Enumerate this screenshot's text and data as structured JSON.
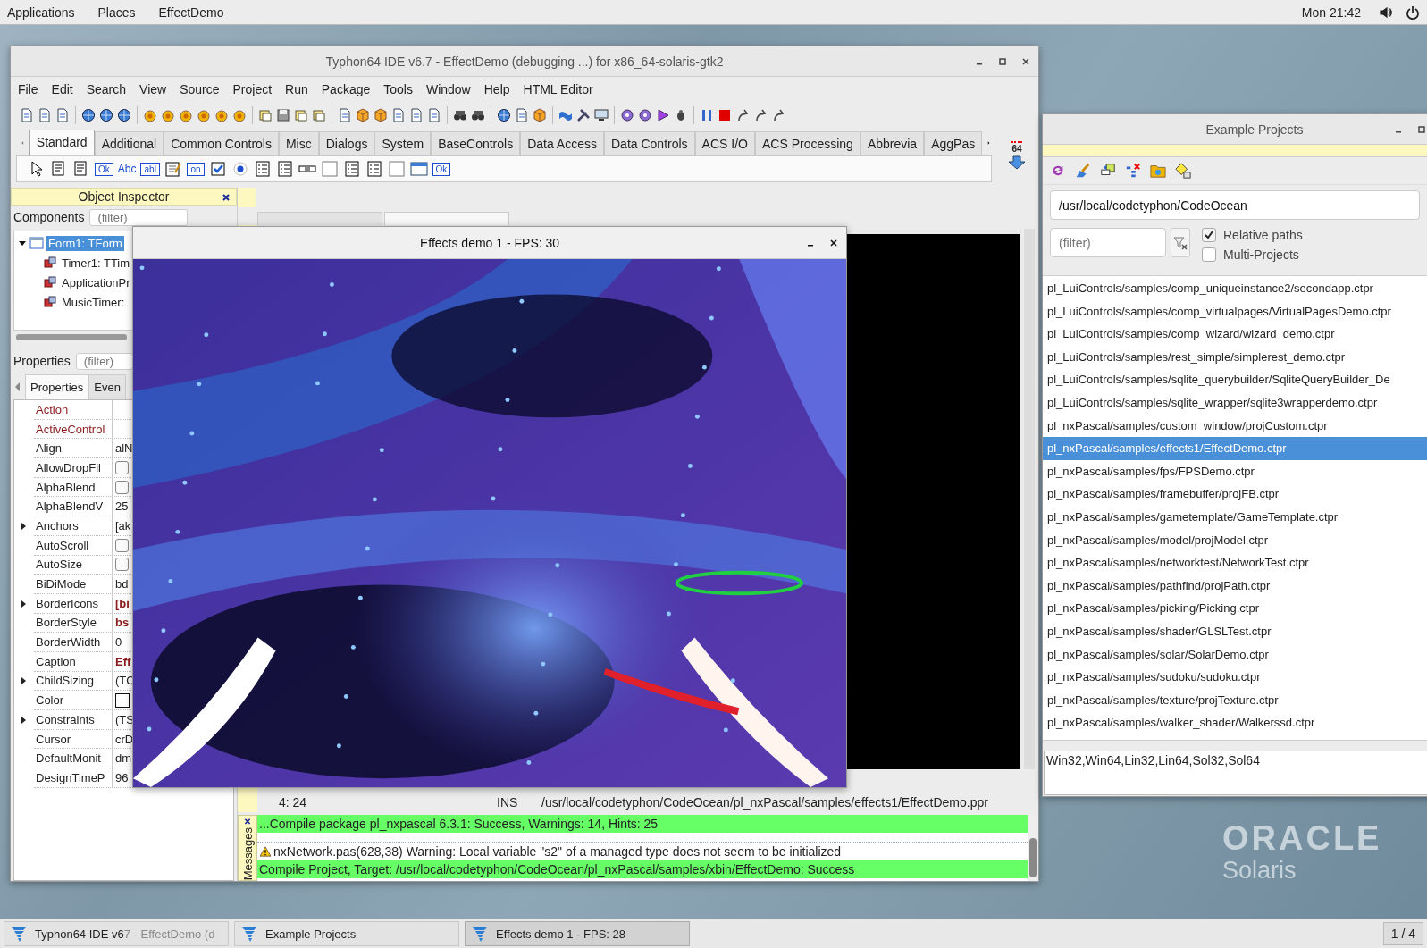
{
  "top_bar": {
    "menus": [
      "Applications",
      "Places",
      "EffectDemo"
    ],
    "clock": "Mon 21:42"
  },
  "ide": {
    "title": "Typhon64 IDE v6.7 - EffectDemo (debugging ...) for x86_64-solaris-gtk2",
    "menu": [
      "File",
      "Edit",
      "Search",
      "View",
      "Source",
      "Project",
      "Run",
      "Package",
      "Tools",
      "Window",
      "Help",
      "HTML Editor"
    ],
    "palette_tabs": [
      {
        "label": "Standard",
        "selected": true
      },
      {
        "label": "Additional",
        "selected": false
      },
      {
        "label": "Common Controls",
        "selected": false
      },
      {
        "label": "Misc",
        "selected": false
      },
      {
        "label": "Dialogs",
        "selected": false
      },
      {
        "label": "System",
        "selected": false
      },
      {
        "label": "BaseControls",
        "selected": false
      },
      {
        "label": "Data Access",
        "selected": false
      },
      {
        "label": "Data Controls",
        "selected": false
      },
      {
        "label": "ACS I/O",
        "selected": false
      },
      {
        "label": "ACS Processing",
        "selected": false
      },
      {
        "label": "Abbrevia",
        "selected": false
      },
      {
        "label": "AggPas",
        "selected": false
      }
    ],
    "palette_badge": "64",
    "palette_items": [
      {
        "kind": "pointer"
      },
      {
        "kind": "menu"
      },
      {
        "kind": "menu"
      },
      {
        "kind": "text",
        "label": "Ok"
      },
      {
        "kind": "plain",
        "label": "Abc"
      },
      {
        "kind": "text",
        "label": "abI"
      },
      {
        "kind": "memo"
      },
      {
        "kind": "text",
        "label": "on"
      },
      {
        "kind": "check"
      },
      {
        "kind": "radio"
      },
      {
        "kind": "list"
      },
      {
        "kind": "list"
      },
      {
        "kind": "bar"
      },
      {
        "kind": "panel"
      },
      {
        "kind": "list"
      },
      {
        "kind": "list"
      },
      {
        "kind": "panel"
      },
      {
        "kind": "window"
      },
      {
        "kind": "text",
        "label": "Ok"
      }
    ],
    "object_inspector": {
      "title": "Object Inspector",
      "components_label": "Components",
      "components_filter": {
        "placeholder": "(filter)"
      },
      "tree": [
        {
          "label": "Form1: TForm",
          "selected": true,
          "expanded": true,
          "children": [
            {
              "label": "Timer1: TTim",
              "selected": false
            },
            {
              "label": "ApplicationPr",
              "selected": false
            },
            {
              "label": "MusicTimer:",
              "selected": false
            }
          ]
        }
      ],
      "properties_label": "Properties",
      "properties_filter": {
        "placeholder": "(filter)"
      },
      "tabs": [
        {
          "label": "Properties",
          "selected": true
        },
        {
          "label": "Even",
          "selected": false
        }
      ],
      "properties": [
        {
          "name": "Action",
          "kind": "text",
          "reference": true
        },
        {
          "name": "ActiveControl",
          "kind": "text",
          "reference": true
        },
        {
          "name": "Align",
          "kind": "text",
          "value": "alN"
        },
        {
          "name": "AllowDropFil",
          "kind": "check",
          "checked": false
        },
        {
          "name": "AlphaBlend",
          "kind": "check",
          "checked": false
        },
        {
          "name": "AlphaBlendV",
          "kind": "text",
          "value": "25"
        },
        {
          "name": "Anchors",
          "kind": "text",
          "value": "[ak",
          "expandable": true
        },
        {
          "name": "AutoScroll",
          "kind": "check",
          "checked": false
        },
        {
          "name": "AutoSize",
          "kind": "check",
          "checked": false
        },
        {
          "name": "BiDiMode",
          "kind": "text",
          "value": "bd"
        },
        {
          "name": "BorderIcons",
          "kind": "text",
          "value": "[bi",
          "expandable": true,
          "modified": true
        },
        {
          "name": "BorderStyle",
          "kind": "text",
          "value": "bs",
          "modified": true
        },
        {
          "name": "BorderWidth",
          "kind": "text",
          "value": "0"
        },
        {
          "name": "Caption",
          "kind": "text",
          "value": "Eff",
          "modified": true
        },
        {
          "name": "ChildSizing",
          "kind": "text",
          "value": "(TC",
          "expandable": true
        },
        {
          "name": "Color",
          "kind": "color"
        },
        {
          "name": "Constraints",
          "kind": "text",
          "value": "(TS",
          "expandable": true
        },
        {
          "name": "Cursor",
          "kind": "text",
          "value": "crD"
        },
        {
          "name": "DefaultMonit",
          "kind": "text",
          "value": "dm"
        },
        {
          "name": "DesignTimeP",
          "kind": "text",
          "value": "96"
        }
      ]
    },
    "editor": {
      "position": "4: 24",
      "mode": "INS",
      "file": "/usr/local/codetyphon/CodeOcean/pl_nxPascal/samples/effects1/EffectDemo.ppr"
    },
    "messages": {
      "title": "Messages",
      "rows": [
        {
          "kind": "success",
          "text": "...Compile package pl_nxpascal 6.3.1: Success, Warnings: 14, Hints: 25"
        },
        {
          "kind": "warning",
          "text": "nxNetwork.pas(628,38) Warning: Local variable \"s2\" of a managed type does not seem to be initialized"
        },
        {
          "kind": "success",
          "text": "Compile Project, Target: /usr/local/codetyphon/CodeOcean/pl_nxPascal/samples/xbin/EffectDemo: Success"
        }
      ]
    }
  },
  "effects_window": {
    "title": "Effects demo 1 - FPS: 30"
  },
  "example_projects": {
    "title": "Example Projects",
    "path": "/usr/local/codetyphon/CodeOcean",
    "filter": {
      "placeholder": "(filter)"
    },
    "options": [
      {
        "label": "Relative paths",
        "checked": true
      },
      {
        "label": "Multi-Projects",
        "checked": false
      }
    ],
    "projects": [
      {
        "label": "pl_LuiControls/samples/comp_uniqueinstance2/secondapp.ctpr",
        "selected": false
      },
      {
        "label": "pl_LuiControls/samples/comp_virtualpages/VirtualPagesDemo.ctpr",
        "selected": false
      },
      {
        "label": "pl_LuiControls/samples/comp_wizard/wizard_demo.ctpr",
        "selected": false
      },
      {
        "label": "pl_LuiControls/samples/rest_simple/simplerest_demo.ctpr",
        "selected": false
      },
      {
        "label": "pl_LuiControls/samples/sqlite_querybuilder/SqliteQueryBuilder_De",
        "selected": false
      },
      {
        "label": "pl_LuiControls/samples/sqlite_wrapper/sqlite3wrapperdemo.ctpr",
        "selected": false
      },
      {
        "label": "pl_nxPascal/samples/custom_window/projCustom.ctpr",
        "selected": false
      },
      {
        "label": "pl_nxPascal/samples/effects1/EffectDemo.ctpr",
        "selected": true
      },
      {
        "label": "pl_nxPascal/samples/fps/FPSDemo.ctpr",
        "selected": false
      },
      {
        "label": "pl_nxPascal/samples/framebuffer/projFB.ctpr",
        "selected": false
      },
      {
        "label": "pl_nxPascal/samples/gametemplate/GameTemplate.ctpr",
        "selected": false
      },
      {
        "label": "pl_nxPascal/samples/model/projModel.ctpr",
        "selected": false
      },
      {
        "label": "pl_nxPascal/samples/networktest/NetworkTest.ctpr",
        "selected": false
      },
      {
        "label": "pl_nxPascal/samples/pathfind/projPath.ctpr",
        "selected": false
      },
      {
        "label": "pl_nxPascal/samples/picking/Picking.ctpr",
        "selected": false
      },
      {
        "label": "pl_nxPascal/samples/shader/GLSLTest.ctpr",
        "selected": false
      },
      {
        "label": "pl_nxPascal/samples/solar/SolarDemo.ctpr",
        "selected": false
      },
      {
        "label": "pl_nxPascal/samples/sudoku/sudoku.ctpr",
        "selected": false
      },
      {
        "label": "pl_nxPascal/samples/texture/projTexture.ctpr",
        "selected": false
      },
      {
        "label": "pl_nxPascal/samples/walker_shader/Walkerssd.ctpr",
        "selected": false
      }
    ],
    "platforms": "Win32,Win64,Lin32,Lin64,Sol32,Sol64"
  },
  "desktop": {
    "logo": "ORACLE",
    "logo_subtitle": "Solaris"
  },
  "taskbar": {
    "items": [
      {
        "label": "Typhon64 IDE v6",
        "overflow": "7 - EffectDemo (d",
        "selected": false
      },
      {
        "label": "Example Projects",
        "selected": false
      },
      {
        "label": "Effects demo 1 - FPS: 28",
        "selected": true
      }
    ],
    "pager": "1 / 4"
  }
}
